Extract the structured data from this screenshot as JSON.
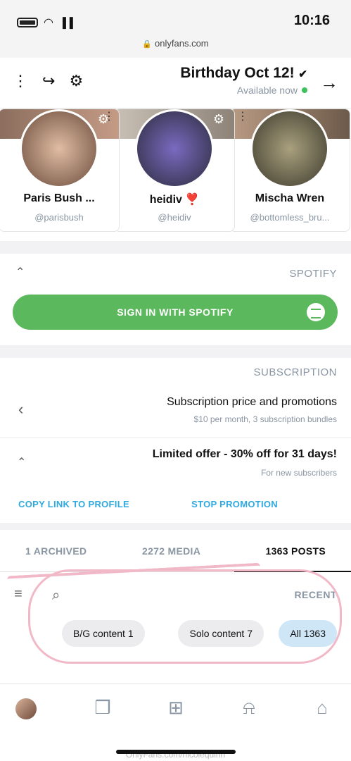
{
  "status": {
    "time": "10:16",
    "url": "onlyfans.com"
  },
  "header": {
    "title": "Birthday Oct 12!",
    "status": "Available now"
  },
  "suggestions": [
    {
      "name": "Mischa Wren",
      "handle": "@bottomless_bru..."
    },
    {
      "name": "heidiv ❣️",
      "handle": "@heidiv"
    },
    {
      "name": "Paris Bush ...",
      "handle": "@parisbush"
    }
  ],
  "spotify": {
    "title": "SPOTIFY",
    "button": "SIGN IN WITH SPOTIFY"
  },
  "subscription": {
    "title": "SUBSCRIPTION",
    "row_title": "Subscription price and promotions",
    "row_sub": "$10 per month, 3 subscription bundles",
    "offer_title": "Limited offer - 30% off for 31 days!",
    "offer_sub": "For new subscribers",
    "stop": "STOP PROMOTION",
    "copy": "COPY LINK TO PROFILE"
  },
  "tabs": {
    "posts": "1363 POSTS",
    "media": "2272 MEDIA",
    "archived": "1 ARCHIVED"
  },
  "recent": "RECENT",
  "chips": [
    "All 1363",
    "Solo content 7",
    "B/G content 1"
  ],
  "watermark": "OnlyFans.com/nicolequinn",
  "colors": {
    "accent": "#2fa9e0",
    "spotify": "#5cb85c",
    "annotation": "#f1b9c8"
  }
}
